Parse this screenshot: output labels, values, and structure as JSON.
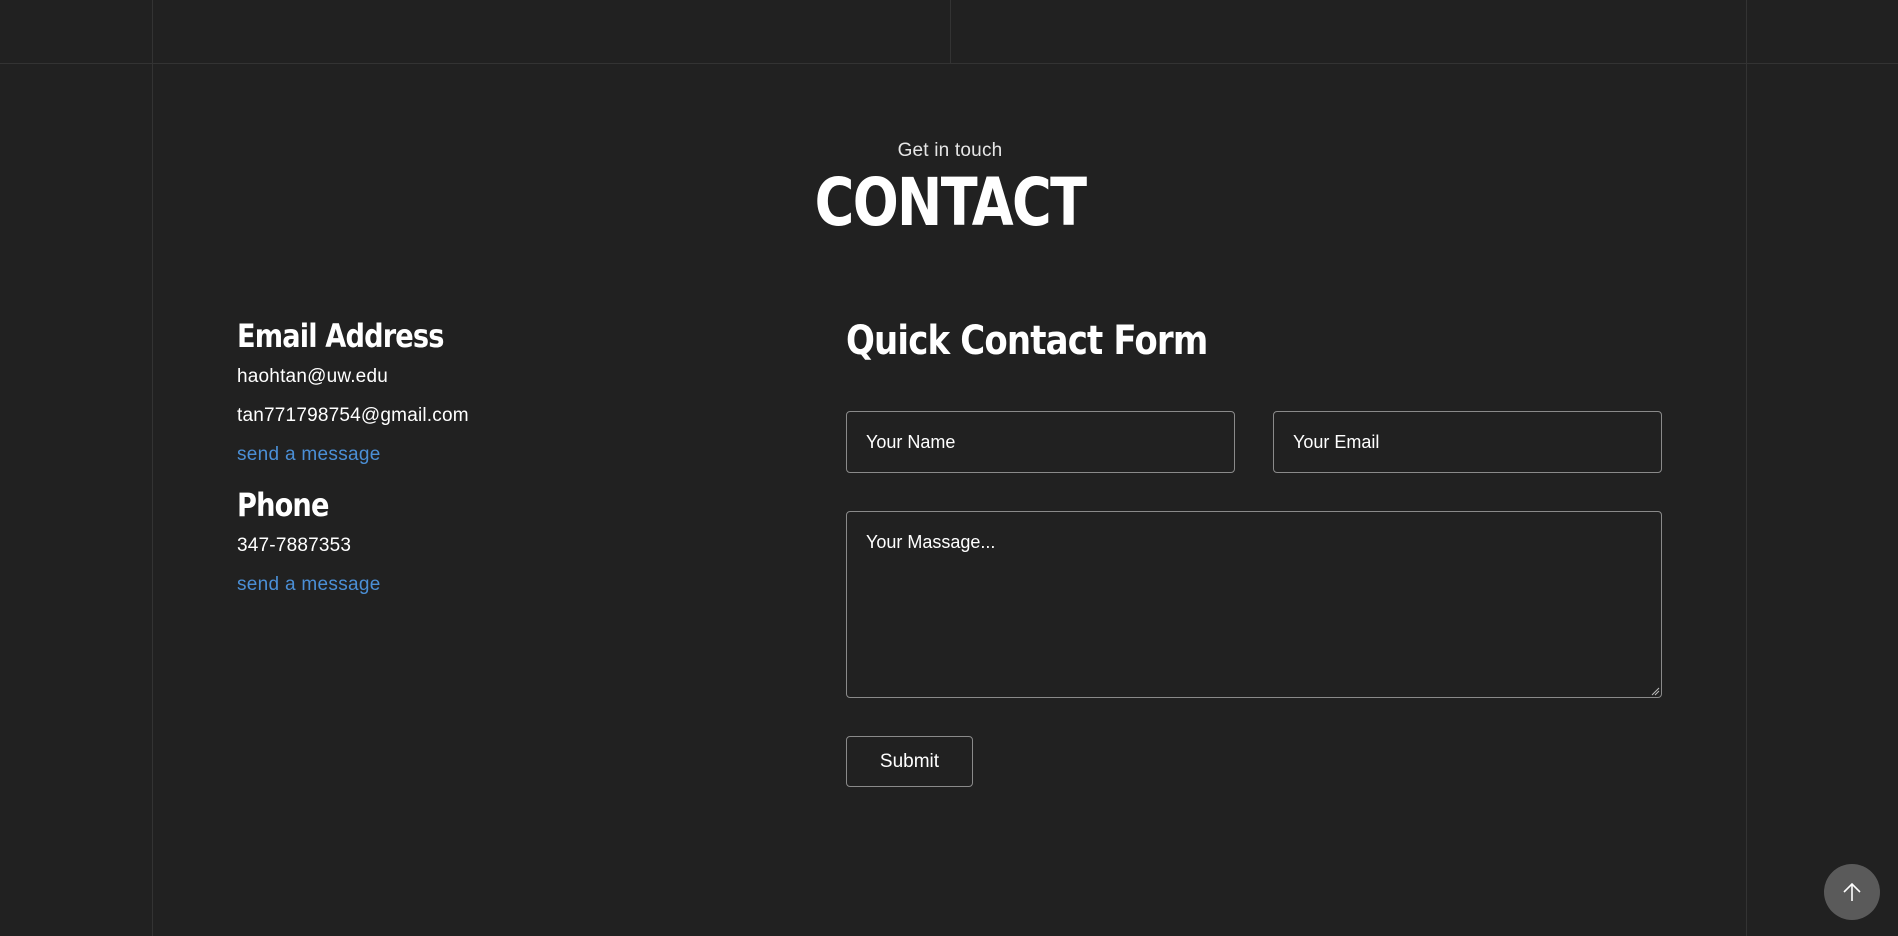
{
  "header": {
    "eyebrow": "Get in touch",
    "title": "CONTACT"
  },
  "info": {
    "email_heading": "Email Address",
    "emails": [
      "haohtan@uw.edu",
      "tan771798754@gmail.com"
    ],
    "email_link": "send a message",
    "phone_heading": "Phone",
    "phone": "347-7887353",
    "phone_link": "send a message",
    "link_color": "#4b8fd6"
  },
  "form": {
    "title": "Quick Contact Form",
    "name_placeholder": "Your Name",
    "email_placeholder": "Your Email",
    "message_placeholder": "Your Massage...",
    "submit_label": "Submit"
  },
  "controls": {
    "scroll_top_icon": "arrow-up-icon"
  },
  "colors": {
    "background": "#212121",
    "grid_line": "#333333",
    "field_border": "#8a8a8a",
    "scroll_button": "#5a5a5a"
  }
}
